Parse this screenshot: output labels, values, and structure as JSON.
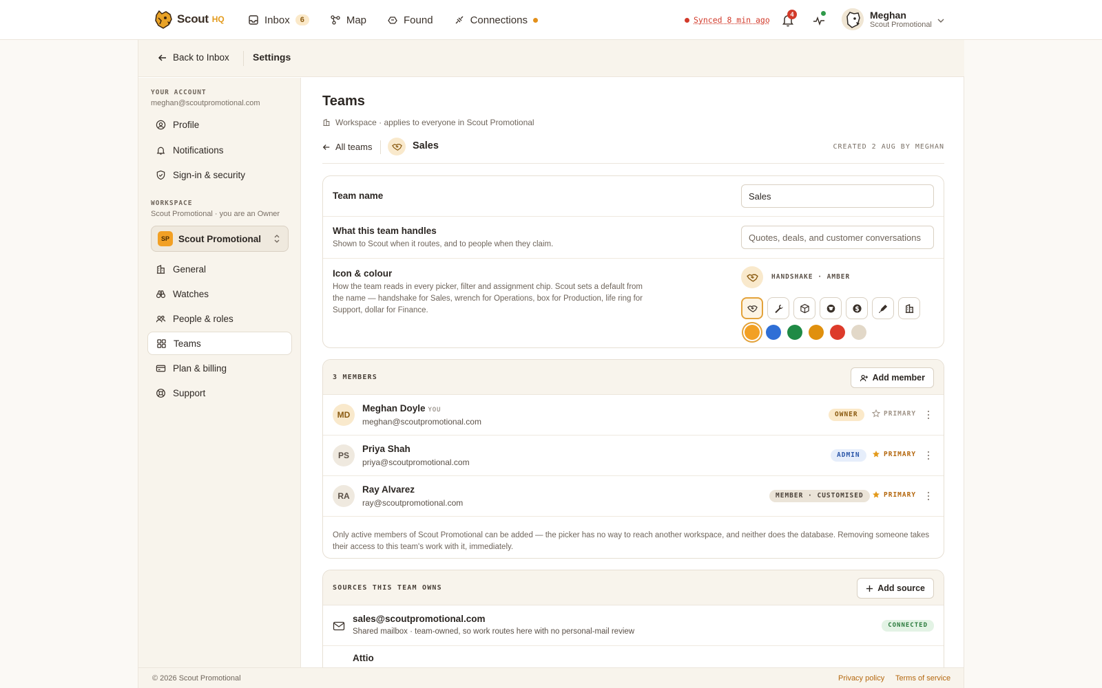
{
  "brand": {
    "name": "Scout",
    "suffix": "HQ"
  },
  "nav": {
    "inbox": {
      "label": "Inbox",
      "count": "6"
    },
    "map": {
      "label": "Map"
    },
    "found": {
      "label": "Found"
    },
    "connections": {
      "label": "Connections"
    }
  },
  "status": {
    "sync": "Synced 8 min ago",
    "notifications_count": "4"
  },
  "user": {
    "name": "Meghan",
    "org": "Scout Promotional"
  },
  "subbar": {
    "back_label": "Back to Inbox",
    "title": "Settings"
  },
  "sidebar": {
    "account_heading": "YOUR ACCOUNT",
    "account_email": "meghan@scoutpromotional.com",
    "account_items": [
      {
        "label": "Profile",
        "icon": "user-circle-icon"
      },
      {
        "label": "Notifications",
        "icon": "bell-icon"
      },
      {
        "label": "Sign-in & security",
        "icon": "shield-icon"
      }
    ],
    "workspace_heading": "WORKSPACE",
    "workspace_sub": "Scout Promotional · you are an Owner",
    "workspace_badge": "SP",
    "workspace_name": "Scout Promotional",
    "workspace_items": [
      {
        "label": "General",
        "icon": "building-icon"
      },
      {
        "label": "Watches",
        "icon": "binoculars-icon"
      },
      {
        "label": "People & roles",
        "icon": "people-icon"
      },
      {
        "label": "Teams",
        "icon": "teams-icon",
        "active": true
      },
      {
        "label": "Plan & billing",
        "icon": "card-icon"
      },
      {
        "label": "Support",
        "icon": "lifering-icon"
      }
    ]
  },
  "page": {
    "title": "Teams",
    "scope": "Workspace · applies to everyone in Scout Promotional",
    "all_teams": "All teams",
    "team": "Sales",
    "created": "CREATED 2 AUG BY MEGHAN"
  },
  "team_form": {
    "name_label": "Team name",
    "name_value": "Sales",
    "handles_label": "What this team handles",
    "handles_help": "Shown to Scout when it routes, and to people when they claim.",
    "handles_placeholder": "Quotes, deals, and customer conversations",
    "icon_label": "Icon & colour",
    "icon_help": "How the team reads in every picker, filter and assignment chip. Scout sets a default from the name — handshake for Sales, wrench for Operations, box for Production, life ring for Support, dollar for Finance.",
    "icon_selection": "HANDSHAKE · AMBER",
    "icons": [
      "handshake-icon",
      "wrench-icon",
      "box-icon",
      "lifering-icon",
      "dollar-icon",
      "pen-icon",
      "building-icon"
    ],
    "colors": [
      "#f2a024",
      "#2f6fd6",
      "#1f8a45",
      "#e0900e",
      "#dd3b2b",
      "#e2d8c8"
    ]
  },
  "members": {
    "heading": "3 MEMBERS",
    "add_label": "Add member",
    "you_tag": "YOU",
    "list": [
      {
        "initials": "MD",
        "name": "Meghan Doyle",
        "email": "meghan@scoutpromotional.com",
        "role": "OWNER",
        "primary": "PRIMARY",
        "is_primary": false,
        "is_you": true
      },
      {
        "initials": "PS",
        "name": "Priya Shah",
        "email": "priya@scoutpromotional.com",
        "role": "ADMIN",
        "primary": "PRIMARY",
        "is_primary": true
      },
      {
        "initials": "RA",
        "name": "Ray Alvarez",
        "email": "ray@scoutpromotional.com",
        "role": "MEMBER · CUSTOMISED",
        "primary": "PRIMARY",
        "is_primary": true
      }
    ],
    "note": "Only active members of Scout Promotional can be added — the picker has no way to reach another workspace, and neither does the database. Removing someone takes their access to this team's work with it, immediately."
  },
  "sources": {
    "heading": "SOURCES THIS TEAM OWNS",
    "add_label": "Add source",
    "list": [
      {
        "name": "sales@scoutpromotional.com",
        "desc": "Shared mailbox · team-owned, so work routes here with no personal-mail review",
        "status": "CONNECTED"
      },
      {
        "name": "Attio"
      }
    ]
  },
  "footer": {
    "copyright": "© 2026 Scout Promotional",
    "privacy": "Privacy policy",
    "terms": "Terms of service"
  }
}
